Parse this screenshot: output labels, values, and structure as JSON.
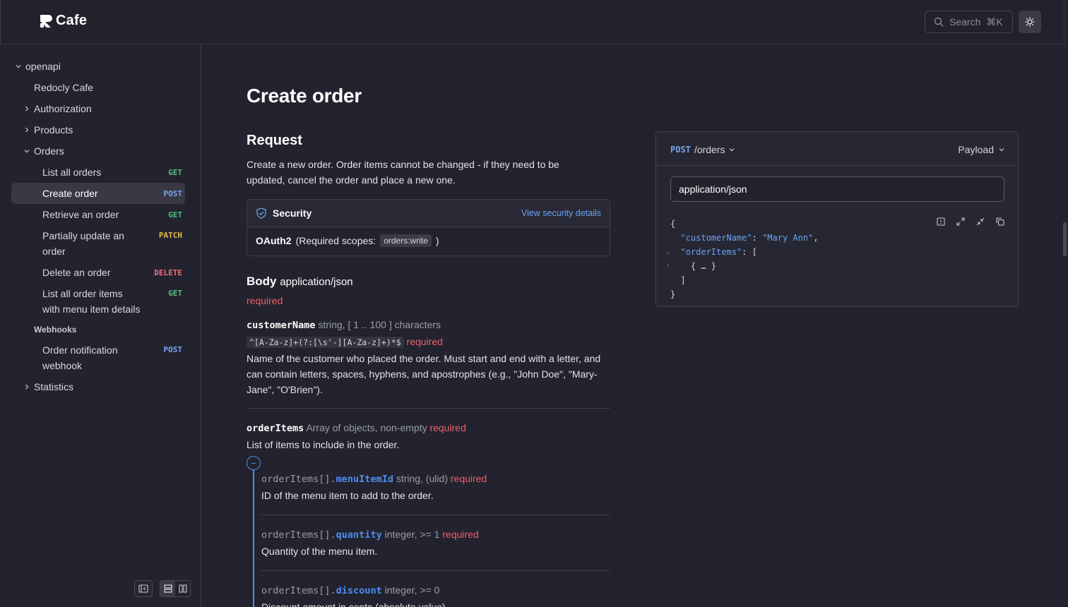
{
  "brand": {
    "name": "Cafe"
  },
  "header": {
    "search_label": "Search",
    "search_shortcut": "⌘K"
  },
  "sidebar": {
    "root": "openapi",
    "items": [
      {
        "label": "Redocly Cafe"
      },
      {
        "label": "Authorization"
      },
      {
        "label": "Products"
      },
      {
        "label": "Orders"
      },
      {
        "label": "List all orders",
        "method": "GET"
      },
      {
        "label": "Create order",
        "method": "POST"
      },
      {
        "label": "Retrieve an order",
        "method": "GET"
      },
      {
        "label": "Partially update an order",
        "line1": "Partially update an",
        "line2": "order",
        "method": "PATCH"
      },
      {
        "label": "Delete an order",
        "method": "DELETE"
      },
      {
        "label": "List all order items with menu item details",
        "line1": "List all order items",
        "line2": "with menu item details",
        "method": "GET"
      },
      {
        "label": "Order notification webhook",
        "line1": "Order notification",
        "line2": "webhook",
        "method": "POST"
      },
      {
        "label": "Statistics"
      }
    ],
    "section_webhooks": "Webhooks"
  },
  "main": {
    "title": "Create order",
    "request_heading": "Request",
    "request_description": "Create a new order. Order items cannot be changed - if they need to be updated, cancel the order and place a new one.",
    "security": {
      "title": "Security",
      "link": "View security details",
      "scheme": "OAuth2",
      "scopes_prefix": "(Required scopes:",
      "scope": "orders:write",
      "scopes_suffix": ")"
    },
    "body": {
      "label": "Body",
      "content_type": "application/json",
      "required": "required"
    },
    "fields": [
      {
        "name": "customerName",
        "type": "string, [ 1 .. 100 ] characters",
        "pattern": "^[A-Za-z]+(?:[\\s'-][A-Za-z]+)*$",
        "required": "required",
        "description": "Name of the customer who placed the order. Must start and end with a letter, and can contain letters, spaces, hyphens, and apostrophes (e.g., \"John Doe\", \"Mary-Jane\", \"O'Brien\")."
      },
      {
        "name": "orderItems",
        "type": "Array of objects, non-empty",
        "required": "required",
        "description": "List of items to include in the order."
      }
    ],
    "collapse_symbol": "−",
    "subfields": [
      {
        "prefix": "orderItems[].",
        "name": "menuItemId",
        "type": "string, (ulid)",
        "required": "required",
        "description": "ID of the menu item to add to the order."
      },
      {
        "prefix": "orderItems[].",
        "name": "quantity",
        "type": "integer, >= 1",
        "required": "required",
        "description": "Quantity of the menu item."
      },
      {
        "prefix": "orderItems[].",
        "name": "discount",
        "type": "integer, >= 0",
        "required": "",
        "description": "Discount amount in cents (absolute value)."
      }
    ]
  },
  "panel": {
    "method": "POST",
    "path": "/orders",
    "mode": "Payload",
    "content_type": "application/json",
    "code": {
      "l1": "{",
      "key1": "\"customerName\"",
      "colon": ": ",
      "val1": "\"Mary Ann\"",
      "comma": ",",
      "key2": "\"orderItems\"",
      "arr_open": ": [",
      "collapsed": "{ … }",
      "arr_close": "]",
      "l_end": "}"
    }
  },
  "colors": {
    "background": "#22232e",
    "accent": "#4f8cf0",
    "required": "#ef5f6b",
    "get": "#4ec07a",
    "post": "#7aa5ef",
    "patch": "#e6b94a",
    "delete": "#ef6e7a"
  }
}
